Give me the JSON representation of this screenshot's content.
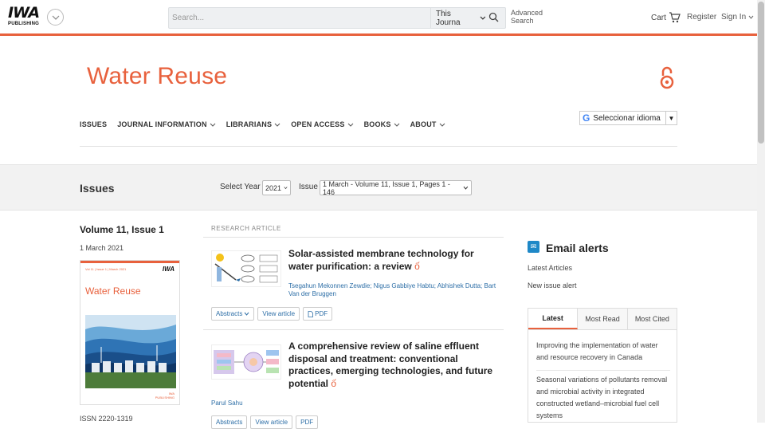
{
  "header": {
    "logo_text": "IWA",
    "logo_sub": "PUBLISHING",
    "search_placeholder": "Search...",
    "search_scope": "This Journa",
    "advanced_search_line1": "Advanced",
    "advanced_search_line2": "Search",
    "cart_label": "Cart",
    "register_label": "Register",
    "signin_label": "Sign In"
  },
  "journal": {
    "title": "Water Reuse"
  },
  "nav": {
    "items": [
      {
        "label": "ISSUES"
      },
      {
        "label": "JOURNAL INFORMATION"
      },
      {
        "label": "LIBRARIANS"
      },
      {
        "label": "OPEN ACCESS"
      },
      {
        "label": "BOOKS"
      },
      {
        "label": "ABOUT"
      }
    ],
    "language_label": "Seleccionar idioma"
  },
  "issues_bar": {
    "heading": "Issues",
    "select_year_label": "Select Year",
    "year_value": "2021",
    "issue_label": "Issue",
    "issue_value": "1 March - Volume 11, Issue 1, Pages 1 - 146"
  },
  "issue_info": {
    "volume": "Volume 11, Issue 1",
    "date": "1 March 2021",
    "cover_title": "Water Reuse",
    "cover_meta": "Vol 11 | Issue 1 | March 2021",
    "cover_logo": "IWA",
    "issn": "ISSN 2220-1319"
  },
  "articles": {
    "section_label": "RESEARCH ARTICLE",
    "items": [
      {
        "title": "Solar-assisted membrane technology for water purification: a review",
        "authors": "Tsegahun Mekonnen Zewdie; Nigus Gabbiye Habtu; Abhishek Dutta; Bart Van der Bruggen",
        "abstracts_label": "Abstracts",
        "view_label": "View article",
        "pdf_label": "PDF"
      },
      {
        "title": "A comprehensive review of saline effluent disposal and treatment: conventional practices, emerging technologies, and future potential",
        "authors": "Parul Sahu",
        "abstracts_label": "Abstracts",
        "view_label": "View article",
        "pdf_label": "PDF"
      }
    ]
  },
  "sidebar": {
    "alerts_title": "Email alerts",
    "latest_articles_label": "Latest Articles",
    "new_issue_label": "New issue alert",
    "tabs": [
      {
        "label": "Latest"
      },
      {
        "label": "Most Read"
      },
      {
        "label": "Most Cited"
      }
    ],
    "latest_items": [
      {
        "title": "Improving the implementation of water and resource recovery in Canada"
      },
      {
        "title": "Seasonal variations of pollutants removal and microbial activity in integrated constructed wetland–microbial fuel cell systems"
      }
    ]
  },
  "colors": {
    "accent": "#e8613d",
    "link": "#2e6fa7",
    "alert_icon": "#1e88c7"
  }
}
